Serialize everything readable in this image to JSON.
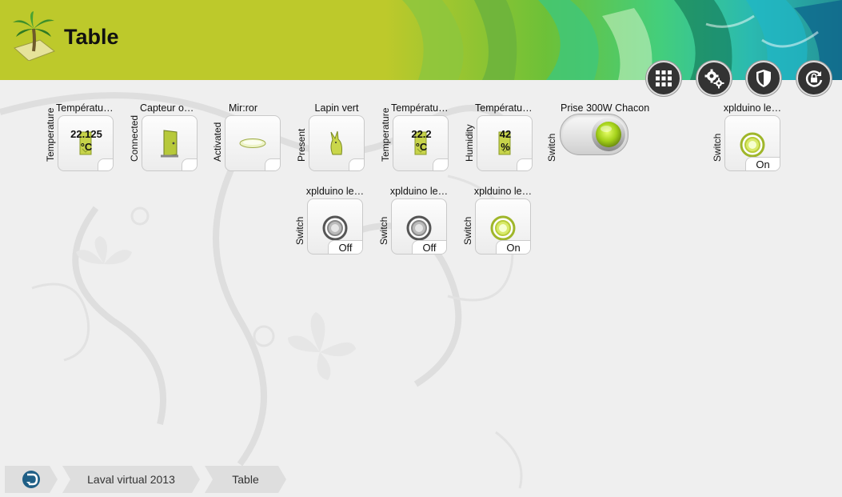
{
  "header": {
    "title": "Table"
  },
  "toolbar": [
    {
      "name": "grid-icon"
    },
    {
      "name": "gears-icon"
    },
    {
      "name": "shield-icon"
    },
    {
      "name": "lock-refresh-icon"
    }
  ],
  "widgets": {
    "w1": {
      "title": "Températur…",
      "side": "Temperature",
      "value": "22.125",
      "unit": "°C"
    },
    "w2": {
      "title": "Capteur ou…",
      "side": "Connected"
    },
    "w3": {
      "title": "Mir:ror",
      "side": "Activated"
    },
    "w4": {
      "title": "Lapin vert",
      "side": "Present"
    },
    "w5": {
      "title": "Températur…",
      "side": "Temperature",
      "value": "22.2",
      "unit": "°C"
    },
    "w6": {
      "title": "Températur…",
      "side": "Humidity",
      "value": "42",
      "unit": "%"
    },
    "w7": {
      "title": "Prise 300W Chacon",
      "side": "Switch"
    },
    "w8": {
      "title": "xplduino le…",
      "side": "Switch",
      "state": "On"
    },
    "w9": {
      "title": "xplduino le…",
      "side": "Switch",
      "state": "Off"
    },
    "w10": {
      "title": "xplduino le…",
      "side": "Switch",
      "state": "Off"
    },
    "w11": {
      "title": "xplduino le…",
      "side": "Switch",
      "state": "On"
    }
  },
  "breadcrumb": {
    "items": [
      "Laval virtual 2013",
      "Table"
    ]
  },
  "colors": {
    "accent": "#bdc92b",
    "on": "#c6dc3a",
    "off": "#555555"
  }
}
